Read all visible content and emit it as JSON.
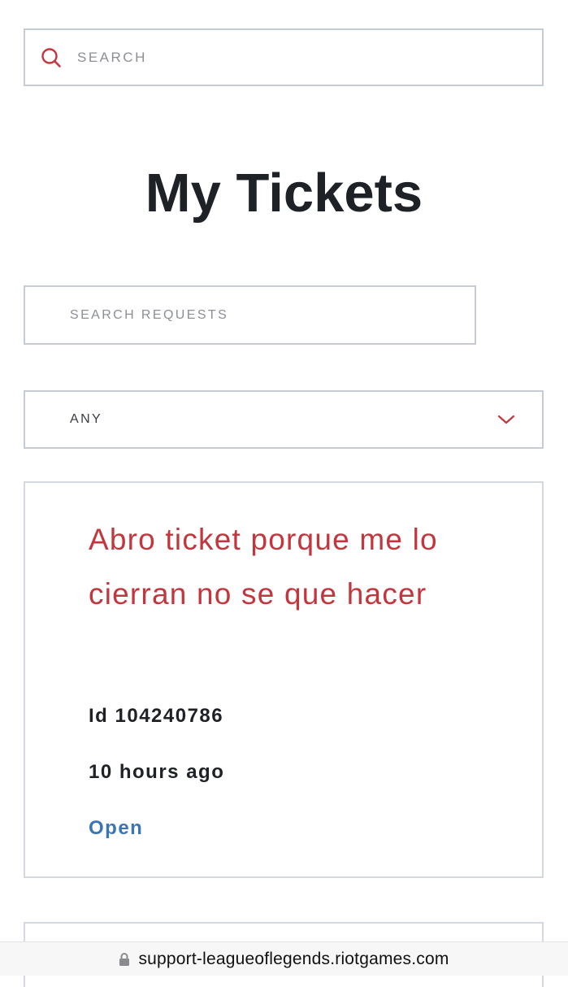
{
  "search": {
    "placeholder": "SEARCH",
    "icon": "search-icon"
  },
  "page": {
    "title": "My Tickets"
  },
  "requests": {
    "search_placeholder": "SEARCH REQUESTS",
    "filter_value": "ANY"
  },
  "tickets": [
    {
      "title": "Abro ticket porque me lo cierran no se que hacer",
      "id": "Id 104240786",
      "time": "10 hours ago",
      "status": "Open"
    }
  ],
  "browser": {
    "url": "support-leagueoflegends.riotgames.com"
  },
  "colors": {
    "accent": "#c2373e",
    "status_open": "#3b76b3",
    "border": "#c7cbd4"
  }
}
